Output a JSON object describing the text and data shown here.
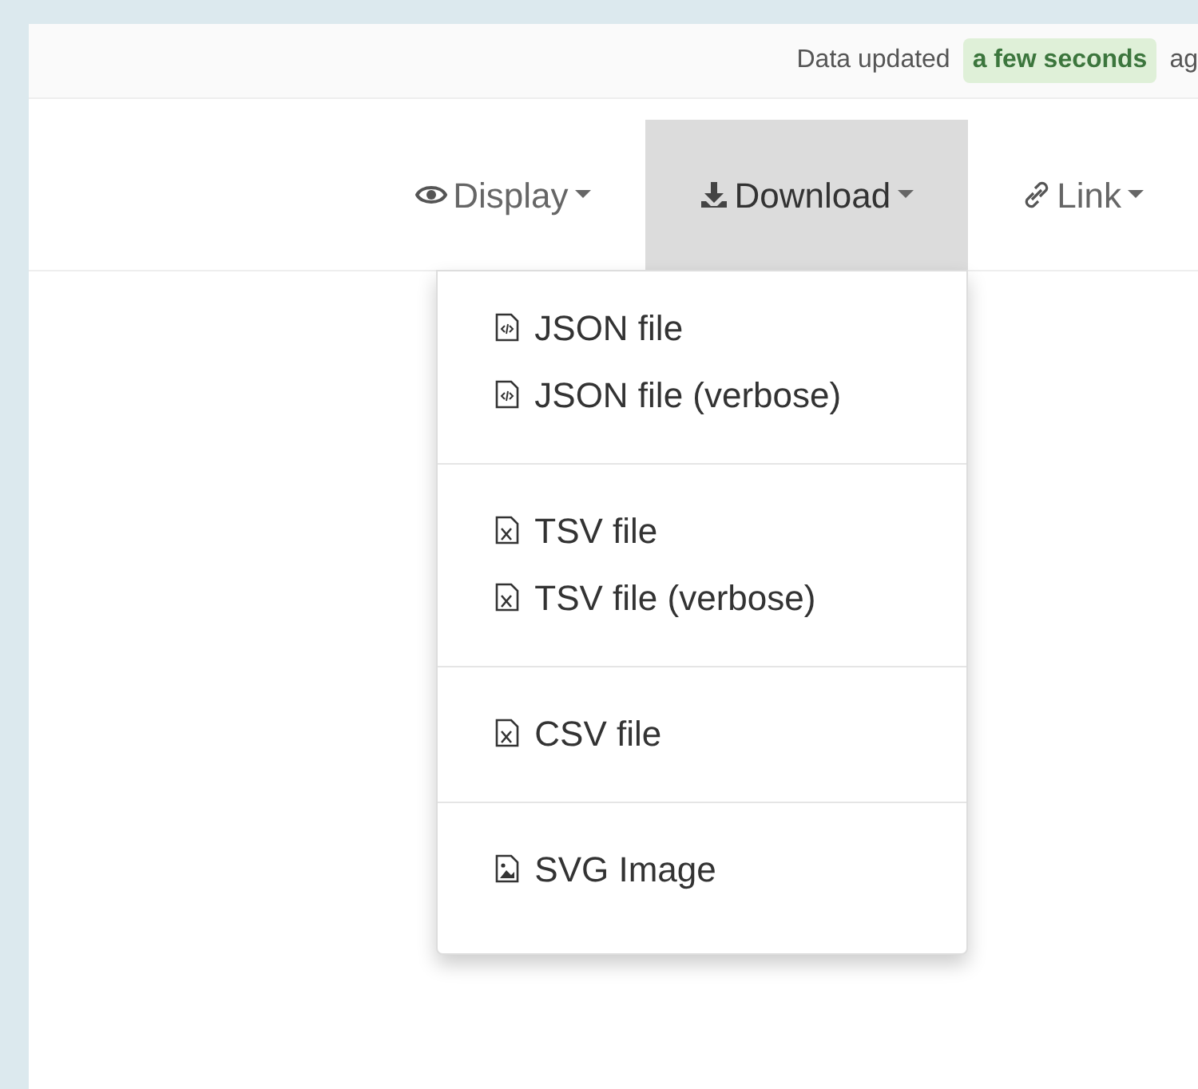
{
  "status": {
    "text": "Data updated",
    "badge": "a few seconds",
    "suffix": "ag"
  },
  "toolbar": [
    {
      "label": "Display",
      "kind": "eye",
      "selected": false
    },
    {
      "label": "Download",
      "kind": "download",
      "selected": true
    },
    {
      "label": "Link",
      "kind": "link",
      "selected": false
    }
  ],
  "download_menu": {
    "groups": [
      {
        "items": [
          {
            "label": "JSON file",
            "kind": "code"
          },
          {
            "label": "JSON file (verbose)",
            "kind": "code"
          }
        ]
      },
      {
        "items": [
          {
            "label": "TSV file",
            "kind": "sheet"
          },
          {
            "label": "TSV file (verbose)",
            "kind": "sheet"
          }
        ]
      },
      {
        "items": [
          {
            "label": "CSV file",
            "kind": "sheet"
          }
        ]
      },
      {
        "items": [
          {
            "label": "SVG Image",
            "kind": "image"
          }
        ]
      }
    ]
  }
}
